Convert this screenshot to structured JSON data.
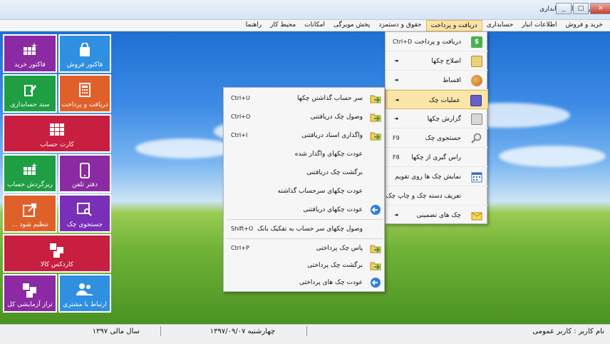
{
  "window": {
    "title": "نرم افزار حسابداری",
    "icon_letter": "A",
    "controls": [
      "_",
      "□",
      "✕"
    ]
  },
  "menu": [
    {
      "label": "خرید و فروش"
    },
    {
      "label": "اطلاعات انبار"
    },
    {
      "label": "حسابداری"
    },
    {
      "label": "دریافت و پرداخت",
      "active": true
    },
    {
      "label": "حقوق و دستمزد"
    },
    {
      "label": "پخش مویرگی"
    },
    {
      "label": "امکانات"
    },
    {
      "label": "محیط کار"
    },
    {
      "label": "راهنما"
    }
  ],
  "tiles": [
    {
      "label": "فاکتور فروش",
      "color": "#2f8fe0",
      "icon": "shopping-bag-icon"
    },
    {
      "label": "فاکتور خرید",
      "color": "#8b2aa3",
      "icon": "grid-sparkle-icon"
    },
    {
      "label": "دریافت و پرداخت",
      "color": "#e0602a",
      "icon": "calculator-icon"
    },
    {
      "label": "سند حسابداری",
      "color": "#1f9e43",
      "icon": "pen-document-icon"
    },
    {
      "label": "کارت حساب",
      "color": "#c81e3f",
      "icon": "table-grid-icon"
    },
    {
      "label": "دفتر تلفن",
      "color": "#8b2aa3",
      "icon": "phone-icon"
    },
    {
      "label": "ریزگردش حساب",
      "color": "#1f9e43",
      "icon": "grid-sparkle-icon"
    },
    {
      "label": "جستجوی چک",
      "color": "#7a2fb8",
      "icon": "search-window-icon"
    },
    {
      "label": "تنظیم شود ...",
      "color": "#e0602a",
      "icon": "external-link-icon"
    },
    {
      "label": "کاردکس کالا",
      "color": "#c81e3f",
      "icon": "squares-icon"
    },
    {
      "label": "ارتباط با مشتری",
      "color": "#2f8fe0",
      "icon": "users-icon"
    },
    {
      "label": "تراز آزمایشی کل",
      "color": "#8b2aa3",
      "icon": "squares-icon"
    }
  ],
  "submenu": [
    {
      "label": "دریافت و پرداخت",
      "shortcut": "Ctrl+D",
      "icon": "dollar-icon",
      "icon_color": "#4caf50"
    },
    {
      "label": "اصلاح چکها",
      "arrow": true,
      "icon": "edit-check-icon",
      "icon_color": "#c9a63a"
    },
    {
      "label": "اقساط",
      "arrow": true,
      "icon": "people-money-icon",
      "icon_color": "#e07a2a"
    },
    {
      "label": "عملیات چک",
      "arrow": true,
      "highlight": true,
      "icon": "book-icon",
      "icon_color": "#5a4fb8"
    },
    {
      "label": "گزارش چکها",
      "arrow": true,
      "icon": "printer-icon",
      "icon_color": "#888888"
    },
    {
      "label": "جستجوی چک",
      "shortcut": "F9",
      "icon": "magnifier-icon",
      "icon_color": "#b0b0b0"
    },
    {
      "label": "راس گیری از چکها",
      "shortcut": "F8",
      "icon": "",
      "icon_color": ""
    },
    {
      "label": "نمایش چک ها روی تقویم",
      "icon": "calendar-icon",
      "icon_color": "#3b6fb6"
    },
    {
      "label": "تعریف دسته چک و چاپ چک",
      "icon": "",
      "icon_color": ""
    },
    {
      "label": "چک های تضمینی",
      "arrow": true,
      "icon": "envelope-icon",
      "icon_color": "#e8c040"
    }
  ],
  "check_operations": [
    {
      "label": "سر حساب گذاشتن چکها",
      "shortcut": "Ctrl+U",
      "icon": "folder-arrow-icon"
    },
    {
      "label": "وصول چک دریافتنی",
      "shortcut": "Ctrl+O",
      "icon": "folder-arrow-icon"
    },
    {
      "label": "واگذاری اسناد دریافتنی",
      "shortcut": "Ctrl+I",
      "icon": "folder-arrow-icon"
    },
    {
      "label": "عودت چکهای واگذار شده",
      "shortcut": "",
      "icon": ""
    },
    {
      "label": "برگشت چک دریافتنی",
      "shortcut": "",
      "icon": ""
    },
    {
      "label": "عودت چکهای سرحساب گذاشته",
      "shortcut": "",
      "icon": ""
    },
    {
      "label": "عودت چکهای دریافتنی",
      "shortcut": "",
      "icon": "return-circle-icon"
    },
    {
      "label": "وصول چکهای سر حساب به تفکیک بانک",
      "shortcut": "Shift+O",
      "icon": "",
      "separator_before": true
    },
    {
      "label": "پاس چک پرداختی",
      "shortcut": "Ctrl+P",
      "icon": "folder-arrow-icon",
      "separator_before": true
    },
    {
      "label": "برگشت چک پرداختی",
      "shortcut": "",
      "icon": "folder-arrow-icon"
    },
    {
      "label": "عودت چک های پرداختی",
      "shortcut": "",
      "icon": "return-circle-icon"
    }
  ],
  "status": {
    "user": "نام کاربر : کاربر عمومی",
    "date": "چهارشنبه   ۱۳۹۷/۰۹/۰۷",
    "fiscal_year": "سال مالی ۱۳۹۷"
  }
}
